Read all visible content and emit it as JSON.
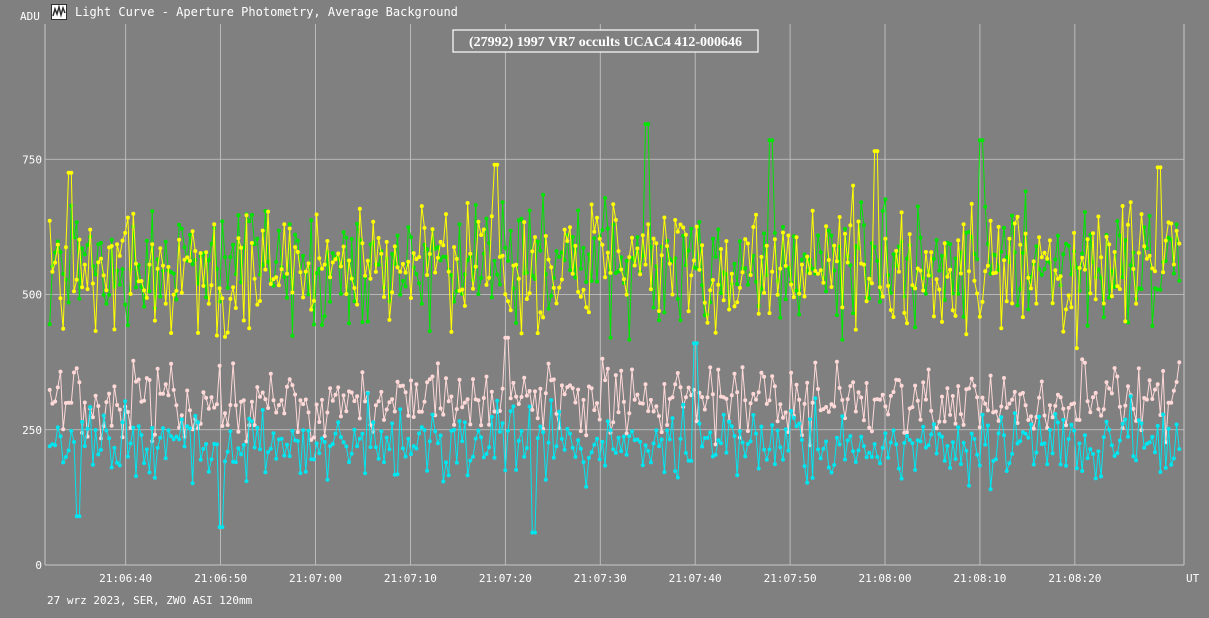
{
  "window": {
    "title": "Light Curve - Aperture Photometry, Average Background",
    "icon": "light-curve-app-icon"
  },
  "footer": {
    "text": "27 wrz 2023, SER, ZWO ASI 120mm"
  },
  "colors": {
    "background": "#808080",
    "grid": "#c8c8c8",
    "green_series": "#00e600",
    "yellow_series": "#ffff00",
    "pink_series": "#ffd8d8",
    "cyan_series": "#00e6f0"
  },
  "chart_data": {
    "type": "line",
    "title": "(27992) 1997 VR7 occults UCAC4 412-000646",
    "ylabel": "ADU",
    "xlabel": "UT",
    "ylim": [
      0,
      1000
    ],
    "y_ticks": [
      0,
      250,
      500,
      750
    ],
    "x_range": [
      "21:06:32",
      "21:08:31"
    ],
    "x_ticks": [
      "21:06:40",
      "21:06:50",
      "21:07:00",
      "21:07:10",
      "21:07:20",
      "21:07:30",
      "21:07:40",
      "21:07:50",
      "21:08:00",
      "21:08:10",
      "21:08:20"
    ],
    "grid": true,
    "legend": "none",
    "series": [
      {
        "color": "#00e600",
        "mean": 555,
        "amplitude": 90,
        "range": [
          370,
          815
        ],
        "sample_points": [
          {
            "t": "21:06:32",
            "v": 445
          },
          {
            "t": "21:07:35",
            "v": 815
          },
          {
            "t": "21:07:48",
            "v": 785
          },
          {
            "t": "21:08:10",
            "v": 785
          }
        ]
      },
      {
        "color": "#ffff00",
        "mean": 545,
        "amplitude": 95,
        "range": [
          310,
          765
        ],
        "sample_points": [
          {
            "t": "21:06:34",
            "v": 725
          },
          {
            "t": "21:07:19",
            "v": 740
          },
          {
            "t": "21:07:59",
            "v": 765
          },
          {
            "t": "21:08:29",
            "v": 735
          }
        ]
      },
      {
        "color": "#ffd8d8",
        "mean": 300,
        "amplitude": 55,
        "range": [
          160,
          480
        ],
        "sample_points": [
          {
            "t": "21:06:34",
            "v": 300
          },
          {
            "t": "21:07:20",
            "v": 420
          },
          {
            "t": "21:08:30",
            "v": 300
          }
        ]
      },
      {
        "color": "#00e6f0",
        "mean": 225,
        "amplitude": 55,
        "range": [
          60,
          410
        ],
        "sample_points": [
          {
            "t": "21:06:35",
            "v": 90
          },
          {
            "t": "21:06:50",
            "v": 70
          },
          {
            "t": "21:07:23",
            "v": 60
          },
          {
            "t": "21:07:40",
            "v": 410
          }
        ]
      }
    ]
  }
}
